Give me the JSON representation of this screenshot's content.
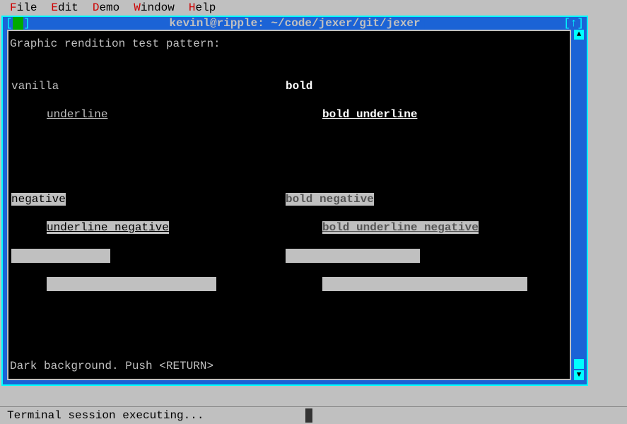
{
  "menubar": {
    "items": [
      {
        "hotkey": "F",
        "rest": "ile"
      },
      {
        "hotkey": "E",
        "rest": "dit"
      },
      {
        "hotkey": "D",
        "rest": "emo"
      },
      {
        "hotkey": "W",
        "rest": "indow"
      },
      {
        "hotkey": "H",
        "rest": "elp"
      }
    ]
  },
  "window": {
    "title": "kevinl@ripple: ~/code/jexer/git/jexer",
    "left_control": "[ ]",
    "right_control": "[↑]"
  },
  "terminal": {
    "heading": "Graphic rendition test pattern:",
    "vanilla": "vanilla",
    "bold": "bold",
    "underline": "underline",
    "bold_underline": "bold underline",
    "negative": "negative",
    "bold_negative": "bold negative",
    "underline_negative": "underline negative",
    "bold_underline_negative": "bold underline negative",
    "bottom": "Dark background. Push <RETURN>"
  },
  "statusbar": {
    "text": "Terminal session executing..."
  }
}
